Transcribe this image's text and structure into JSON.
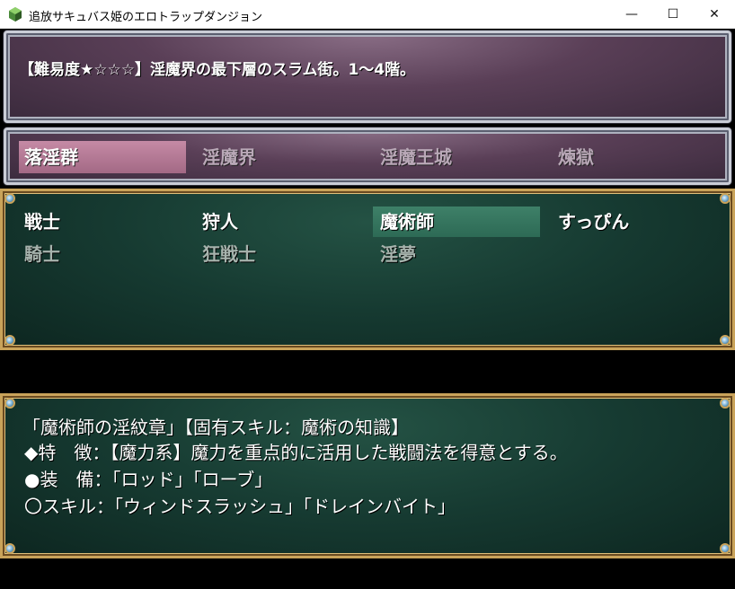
{
  "window": {
    "title": "追放サキュバス姫のエロトラップダンジョン",
    "minimize_glyph": "—",
    "maximize_glyph": "☐",
    "close_glyph": "✕"
  },
  "info": {
    "text": "【難易度★☆☆☆】淫魔界の最下層のスラム街。1〜4階。"
  },
  "tabs": [
    {
      "label": "落淫群",
      "selected": true
    },
    {
      "label": "淫魔界",
      "selected": false
    },
    {
      "label": "淫魔王城",
      "selected": false
    },
    {
      "label": "煉獄",
      "selected": false
    }
  ],
  "classes": [
    {
      "label": "戦士",
      "state": "normal"
    },
    {
      "label": "狩人",
      "state": "normal"
    },
    {
      "label": "魔術師",
      "state": "selected"
    },
    {
      "label": "すっぴん",
      "state": "normal"
    },
    {
      "label": "騎士",
      "state": "dim"
    },
    {
      "label": "狂戦士",
      "state": "dim"
    },
    {
      "label": "淫夢",
      "state": "dim"
    }
  ],
  "description": {
    "line1": "「魔術師の淫紋章」【固有スキル：魔術の知識】",
    "line2": "◆特　徴：【魔力系】魔力を重点的に活用した戦闘法を得意とする。",
    "line3": "●装　備：「ロッド」「ローブ」",
    "line4": "〇スキル：「ウィンドスラッシュ」「ドレインバイト」"
  },
  "colors": {
    "selected_tab": "#b77a97",
    "selected_class": "#357560",
    "frame_gold": "#c9a35a"
  }
}
